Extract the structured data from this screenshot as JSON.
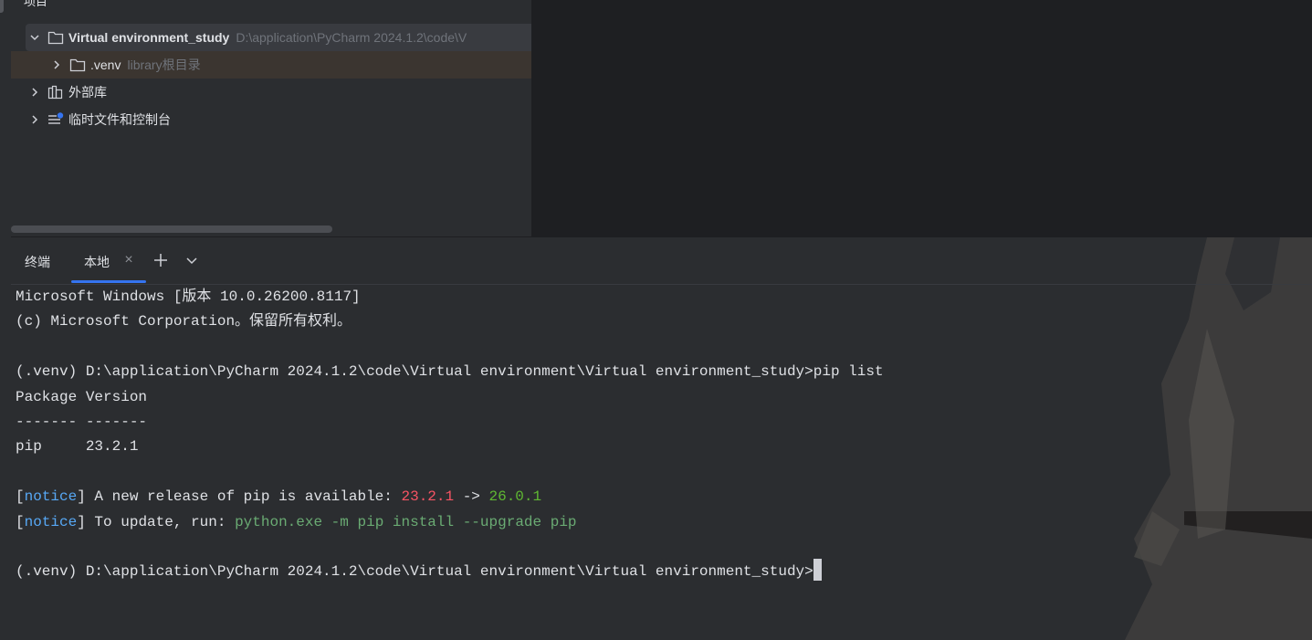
{
  "project_panel": {
    "title": "项目",
    "tree": [
      {
        "name": "Virtual environment_study",
        "path": "D:\\application\\PyCharm 2024.1.2\\code\\V",
        "expanded": true,
        "icon": "folder-icon"
      },
      {
        "name": ".venv",
        "path": "library根目录",
        "expanded": false,
        "icon": "folder-icon"
      },
      {
        "name": "外部库",
        "expanded": false,
        "icon": "library-icon"
      },
      {
        "name": "临时文件和控制台",
        "expanded": false,
        "icon": "scratch-icon"
      }
    ]
  },
  "terminal": {
    "title": "终端",
    "tab_label": "本地",
    "close_glyph": "×",
    "lines": {
      "l1": "Microsoft Windows [版本 10.0.26200.8117]",
      "l2": "(c) Microsoft Corporation。保留所有权利。",
      "l3": "(.venv) D:\\application\\PyCharm 2024.1.2\\code\\Virtual environment\\Virtual environment_study>pip list",
      "l4": "Package Version",
      "l5": "------- -------",
      "l6": "pip     23.2.1",
      "notice1": {
        "open": "[",
        "tag": "notice",
        "close": "]",
        "text": " A new release of pip is available: ",
        "old": "23.2.1",
        "arrow": " -> ",
        "new": "26.0.1"
      },
      "notice2": {
        "open": "[",
        "tag": "notice",
        "close": "]",
        "text": " To update, run: ",
        "cmd": "python.exe -m pip install --upgrade pip"
      },
      "prompt": "(.venv) D:\\application\\PyCharm 2024.1.2\\code\\Virtual environment\\Virtual environment_study>"
    }
  },
  "colors": {
    "accent": "#3574f0",
    "notice": "#57a8f5",
    "old_version": "#f75464",
    "new_version": "#5fb832",
    "command": "#6aab73"
  }
}
